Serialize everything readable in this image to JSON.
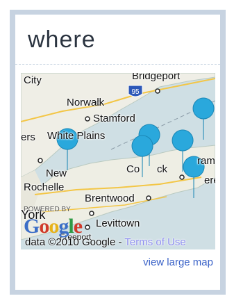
{
  "widget": {
    "title": "where"
  },
  "map": {
    "labels": {
      "city": "City",
      "bridgeport": "Bridgeport",
      "norwalk": "Norwalk",
      "stamford": "Stamford",
      "white_plains": "White Plains",
      "ers": "ers",
      "new": "New",
      "rochelle": "Rochelle",
      "york": "York",
      "brentwood": "Brentwood",
      "levittown": "Levittown",
      "freeport": "Freeport",
      "conn": "Co",
      "ck": "ck",
      "ram": "ram",
      "erea": "erea",
      "highway": "95"
    },
    "powered_by": "POWERED BY",
    "google_logo": "Google",
    "attribution": "data ©2010 Google - ",
    "terms_link": "Terms of Use",
    "marker_color": "#2aa8dc"
  },
  "links": {
    "view_large_map": "view large map"
  }
}
